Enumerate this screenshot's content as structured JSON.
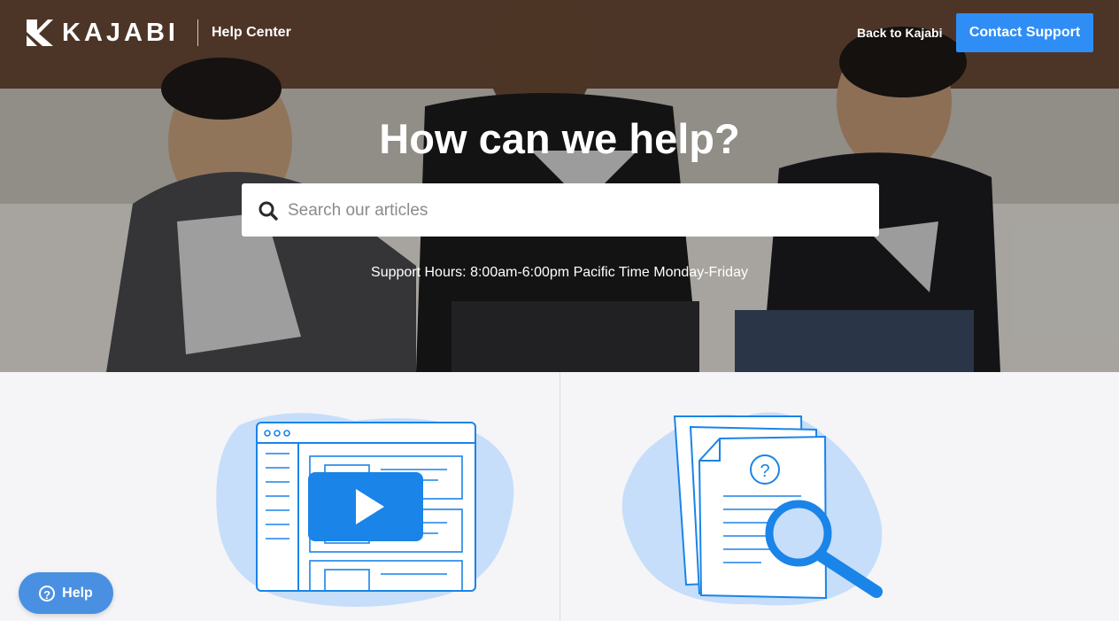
{
  "brand": {
    "name": "KAJABI",
    "section": "Help Center"
  },
  "nav": {
    "back_link": "Back to Kajabi",
    "contact_button": "Contact Support"
  },
  "hero": {
    "title": "How can we help?",
    "search": {
      "placeholder": "Search our articles",
      "value": ""
    },
    "support_hours": "Support Hours: 8:00am-6:00pm Pacific Time Monday-Friday"
  },
  "help_widget": {
    "label": "Help",
    "icon": "?"
  },
  "colors": {
    "accent": "#2f8ef5",
    "illustration_blue": "#1a84e8",
    "blob": "#c6defa"
  }
}
